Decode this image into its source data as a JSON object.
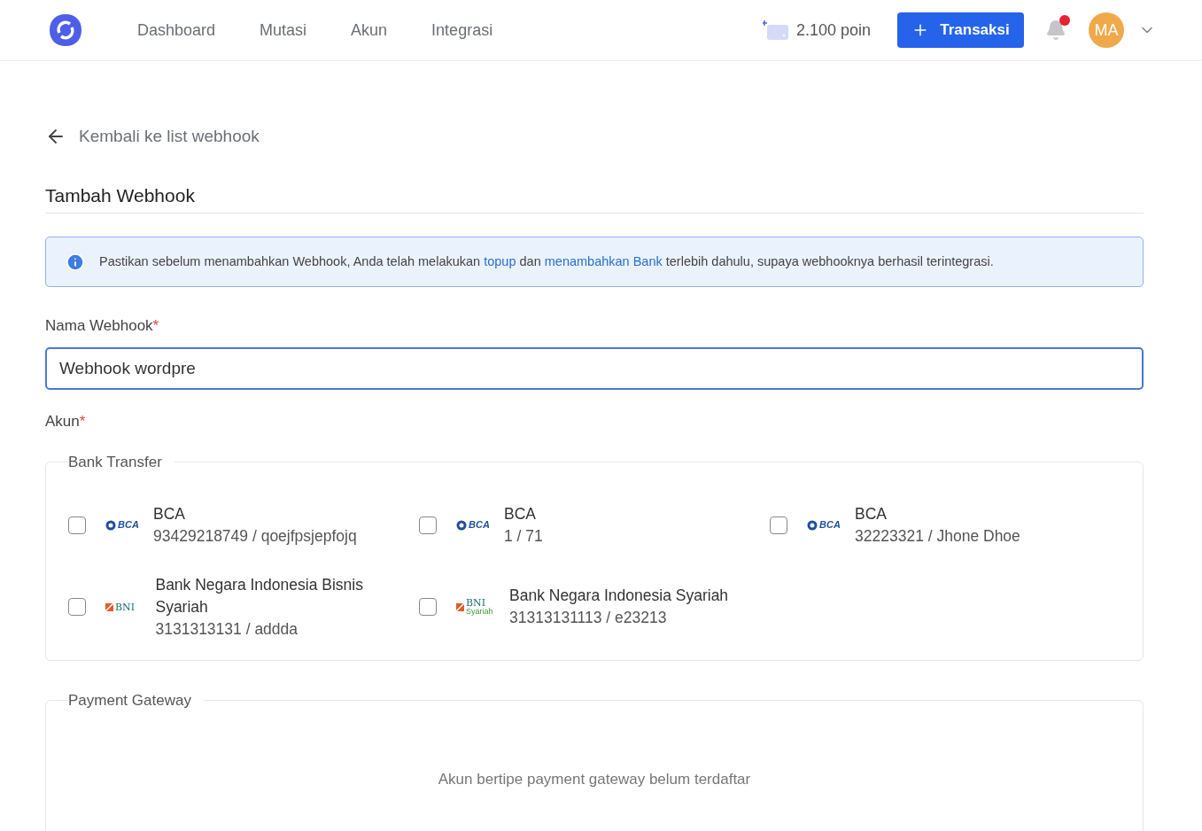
{
  "nav": {
    "items": [
      {
        "label": "Dashboard",
        "selected": false
      },
      {
        "label": "Mutasi",
        "selected": false
      },
      {
        "label": "Akun",
        "selected": false
      },
      {
        "label": "Integrasi",
        "selected": false
      }
    ],
    "points": "2.100 poin",
    "action": "Transaksi",
    "notification": true,
    "avatar": "MA"
  },
  "back_link": "Kembali ke list webhook",
  "title": "Tambah Webhook",
  "alert": [
    {
      "kind": "text",
      "text": "Pastikan sebelum menambahkan Webhook, Anda telah melakukan "
    },
    {
      "kind": "link",
      "text": "topup"
    },
    {
      "kind": "text",
      "text": " dan "
    },
    {
      "kind": "link",
      "text": "menambahkan Bank"
    },
    {
      "kind": "text",
      "text": " terlebih dahulu, supaya webhooknya berhasil terintegrasi."
    }
  ],
  "name_field": {
    "label": "Nama Webhook",
    "required_mark": "*",
    "value": "Webhook wordpre"
  },
  "account_label": {
    "label": "Akun",
    "required_mark": "*"
  },
  "groups": [
    {
      "legend": "Bank Transfer",
      "accounts": [
        {
          "kind": "bca",
          "logo": "BCA",
          "name": "BCA",
          "detail": "93429218749 / qoejfpsjepfojq",
          "checked": false
        },
        {
          "kind": "bca",
          "logo": "BCA",
          "name": "BCA",
          "detail": "1 / 71",
          "checked": false
        },
        {
          "kind": "bca",
          "logo": "BCA",
          "name": "BCA",
          "detail": "32223321 / Jhone Dhoe",
          "checked": false
        },
        {
          "kind": "bni",
          "logo": "BNI",
          "name": "Bank Negara Indonesia Bisnis Syariah",
          "detail": "3131313131 / addda",
          "checked": false
        },
        {
          "kind": "bni_syariah",
          "logo": "BNI",
          "logo_sub": "Syariah",
          "name": "Bank Negara Indonesia Syariah",
          "detail": "31313131113 / e23213",
          "checked": false
        }
      ]
    },
    {
      "legend": "Payment Gateway",
      "empty_text": "Akun bertipe payment gateway belum terdaftar"
    }
  ]
}
